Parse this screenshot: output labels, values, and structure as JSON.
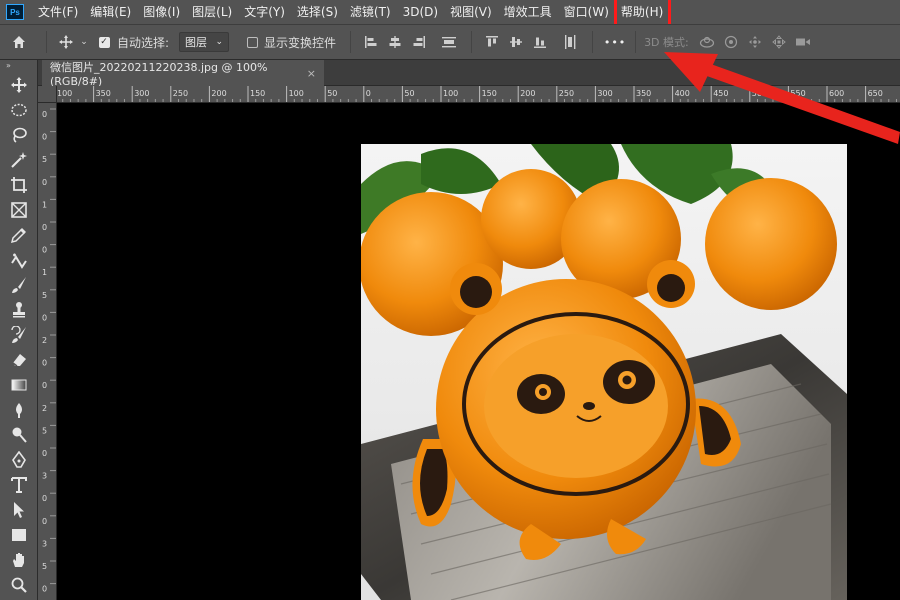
{
  "menu": {
    "logo": "Ps",
    "items": [
      "文件(F)",
      "编辑(E)",
      "图像(I)",
      "图层(L)",
      "文字(Y)",
      "选择(S)",
      "滤镜(T)",
      "3D(D)",
      "视图(V)",
      "增效工具",
      "窗口(W)"
    ],
    "help": "帮助(H)",
    "highlight_color": "#ff1a1a"
  },
  "options": {
    "auto_select_label": "自动选择:",
    "layer_select_value": "图层",
    "show_transform_label": "显示变换控件",
    "more_label": "•••",
    "mode_label": "3D 模式:"
  },
  "document": {
    "tab_title": "微信图片_20220211220238.jpg @ 100%(RGB/8#)",
    "close_symbol": "×"
  },
  "ruler": {
    "h_labels": [
      "100",
      "350",
      "300",
      "250",
      "200",
      "150",
      "100",
      "50",
      "0",
      "50",
      "100",
      "150",
      "200",
      "250",
      "300",
      "350",
      "400",
      "450",
      "500",
      "550",
      "600",
      "650"
    ],
    "v_labels": [
      "0",
      "0",
      "5",
      "0",
      "1",
      "0",
      "0",
      "1",
      "5",
      "0",
      "2",
      "0",
      "0",
      "2",
      "5",
      "0",
      "3",
      "0",
      "0",
      "3",
      "5",
      "0"
    ]
  },
  "icons": {
    "home": "home-icon",
    "move": "move-icon",
    "arrow_annotation_color": "#e8241d"
  }
}
